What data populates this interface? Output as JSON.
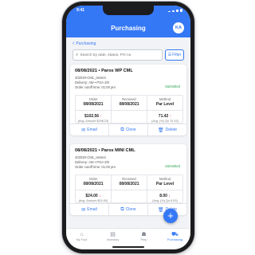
{
  "status_bar": {
    "time": "9:41"
  },
  "header": {
    "title": "Purchasing",
    "avatar_initials": "KA"
  },
  "breadcrumb": {
    "label": "Purchasing"
  },
  "search": {
    "placeholder": "Search by date, status, PO nu",
    "filter_label": "Filter"
  },
  "orders": [
    {
      "name": "08/08/2021 • Paros WP CML",
      "id": "402020-CML_isetors",
      "delivery": "Delivery: AM • POA 2/8",
      "cutoff": "Order cutoff time: 01:00 pm",
      "status": "Submitted",
      "order_label": "Order",
      "order_date": "08/08/2021",
      "received_label": "Received",
      "received_date": "08/08/2021",
      "method_label": "Method",
      "method_value": "Par Level",
      "amount": "$102.56",
      "amount_sub": "(Avg. Amount $298.23)",
      "qty": "71.42",
      "qty_sub": "(Avg. (%) Qo 70.43)"
    },
    {
      "name": "08/08/2021 • Paros MINI CML",
      "id": "402020-CML_isetors",
      "delivery": "Delivery: AM • POA 2/8",
      "cutoff": "Order cutoff time: 01:00 pm",
      "status": "Submitted",
      "order_label": "Order",
      "order_date": "08/08/2021",
      "received_label": "Received",
      "received_date": "08/08/2021",
      "method_label": "Method",
      "method_value": "Par Level",
      "amount": "$24.00",
      "amount_sub": "(Avg. Amount $24.00)",
      "qty": "8.00",
      "qty_sub": "(Avg. (%) Qo 8.00)"
    }
  ],
  "actions": {
    "email": "Email",
    "clone": "Clone",
    "delete": "Delete"
  },
  "tabs": [
    {
      "label": "My Foot",
      "icon": "home-icon"
    },
    {
      "label": "Inventory",
      "icon": "building-icon"
    },
    {
      "label": "Prep",
      "icon": "chef-hat-icon"
    },
    {
      "label": "Purchasing",
      "icon": "cart-icon"
    }
  ],
  "colors": {
    "accent": "#3478f6",
    "status_green": "#27a149",
    "alert_red": "#e0352f"
  }
}
